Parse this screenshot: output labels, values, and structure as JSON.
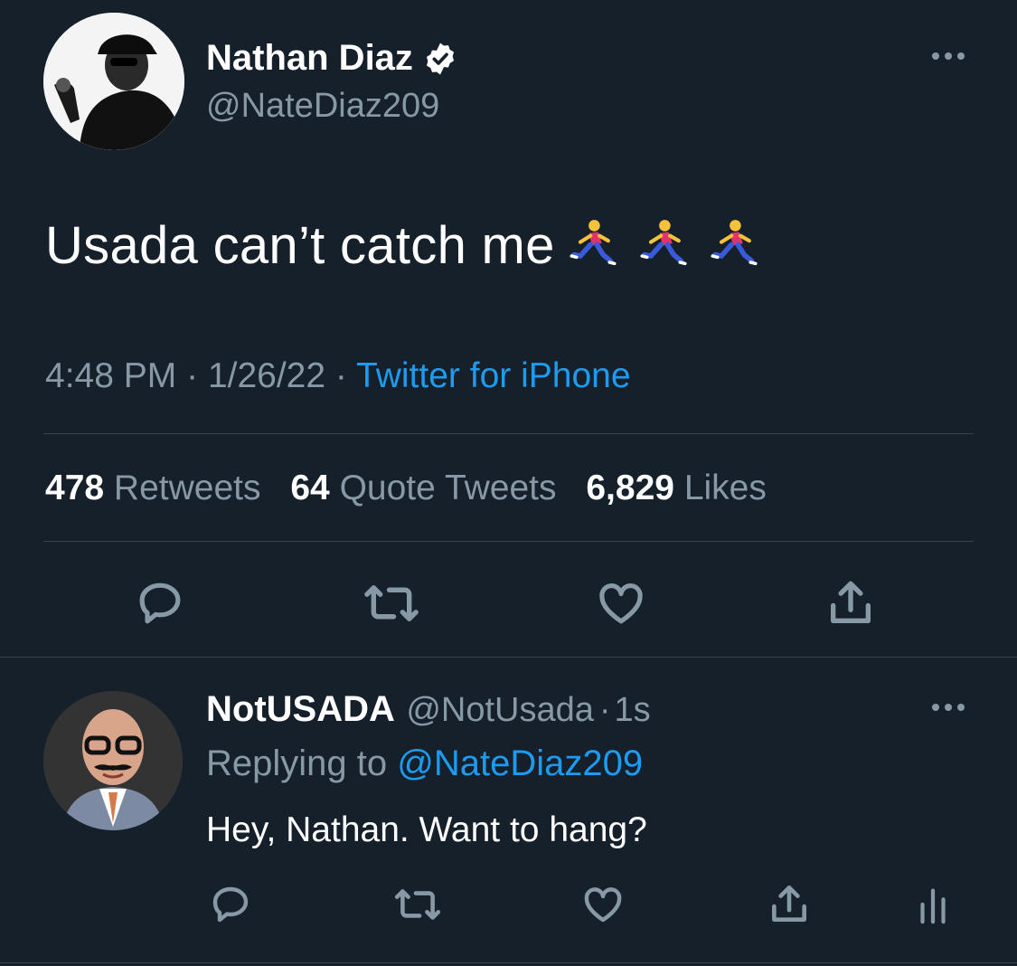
{
  "tweet": {
    "author_name": "Nathan Diaz",
    "author_handle": "@NateDiaz209",
    "verified": true,
    "text": "Usada can’t catch me",
    "emoji": [
      "runner-emoji",
      "runner-emoji",
      "runner-emoji"
    ],
    "time": "4:48 PM",
    "date": "1/26/22",
    "source": "Twitter for iPhone",
    "separator": "·"
  },
  "stats": {
    "retweets_count": "478",
    "retweets_label": "Retweets",
    "quotes_count": "64",
    "quotes_label": "Quote Tweets",
    "likes_count": "6,829",
    "likes_label": "Likes"
  },
  "actions": [
    "reply-icon",
    "retweet-icon",
    "like-icon",
    "share-icon"
  ],
  "reply": {
    "author_name": "NotUSADA",
    "author_handle": "@NotUsada",
    "time": "1s",
    "separator": "·",
    "replying_prefix": "Replying to",
    "replying_to": "@NateDiaz209",
    "text": "Hey, Nathan. Want to hang?",
    "actions": [
      "reply-icon",
      "retweet-icon",
      "like-icon",
      "share-icon",
      "analytics-icon"
    ]
  },
  "colors": {
    "background": "#15202b",
    "text": "#ffffff",
    "secondary": "#8899a6",
    "accent": "#1d9bf0",
    "divider": "#38444d"
  }
}
